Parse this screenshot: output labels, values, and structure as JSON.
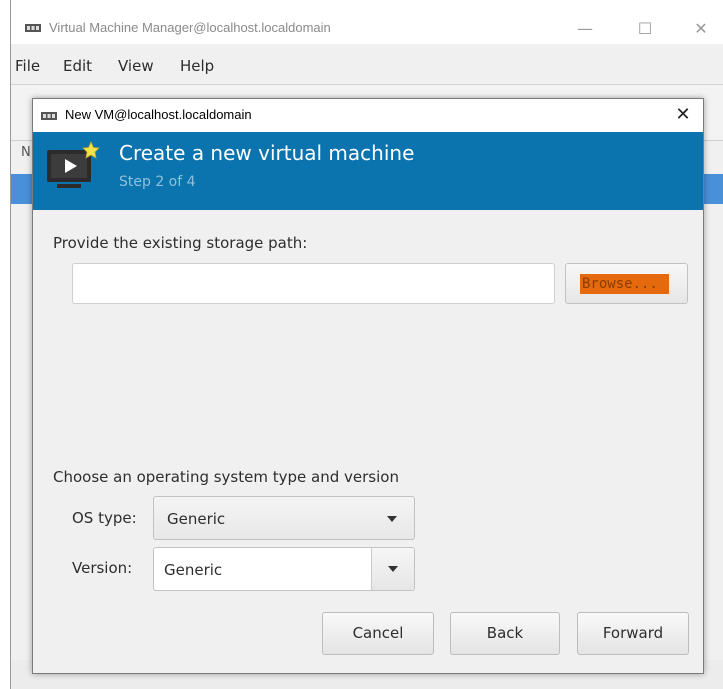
{
  "main_window": {
    "title": "Virtual Machine Manager@localhost.localdomain",
    "controls": {
      "minimize": "—",
      "maximize": "☐",
      "close": "✕"
    },
    "menu": [
      "File",
      "Edit",
      "View",
      "Help"
    ],
    "left_letter": "N"
  },
  "dialog": {
    "title": "New VM@localhost.localdomain",
    "close": "✕",
    "header": {
      "title": "Create a new virtual machine",
      "step": "Step 2 of 4"
    },
    "storage": {
      "label": "Provide the existing storage path:",
      "value": "",
      "browse_label": "Browse..."
    },
    "os": {
      "section_label": "Choose an operating system type and version",
      "os_type_label": "OS type:",
      "os_type_value": "Generic",
      "version_label": "Version:",
      "version_value": "Generic"
    },
    "buttons": {
      "cancel": "Cancel",
      "back": "Back",
      "forward": "Forward"
    }
  },
  "colors": {
    "header_bg": "#0b73ad",
    "browse_highlight": "#e46a0d",
    "selection_blue": "#4a90d9"
  },
  "icons": [
    "virt-manager-app-icon",
    "new-vm-icon",
    "dropdown-arrow-icon"
  ]
}
